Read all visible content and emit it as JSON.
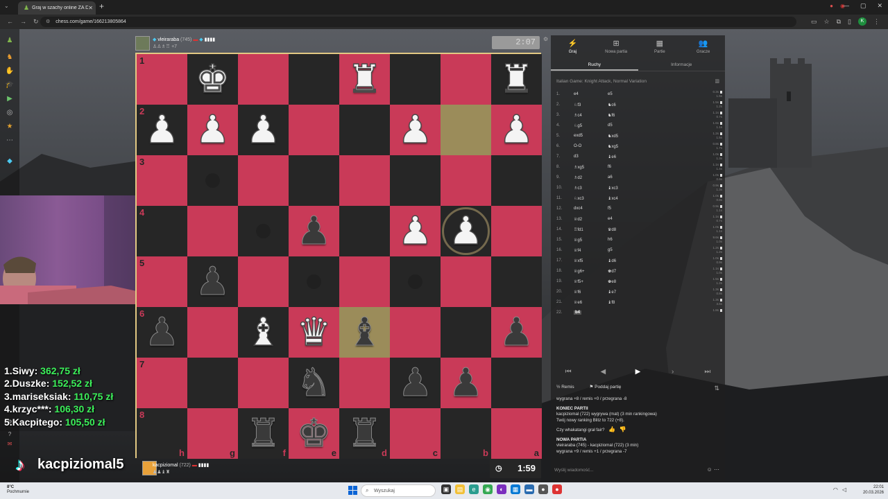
{
  "browser": {
    "tab_title": "Graj w szachy online ZA DARM...",
    "url": "chess.com/game/166213805864"
  },
  "top_player": {
    "name": "vleiraraba",
    "rating": "(745)",
    "captured_extra": "+7",
    "clock": "2:07"
  },
  "bottom_player": {
    "name": "kacpiziomal",
    "rating": "(722)",
    "clock": "1:59"
  },
  "board": {
    "ranks": [
      "1",
      "2",
      "3",
      "4",
      "5",
      "6",
      "7",
      "8"
    ],
    "files": [
      "h",
      "g",
      "f",
      "e",
      "d",
      "c",
      "b",
      "a"
    ]
  },
  "panel": {
    "tabs": [
      "Graj",
      "Nowa partia",
      "Partie",
      "Gracze"
    ],
    "subtabs": [
      "Ruchy",
      "Informacje"
    ],
    "opening": "Italian Game: Knight Attack, Normal Variation",
    "moves": [
      {
        "no": "1.",
        "w": "e4",
        "b": "e5",
        "tw": "0.3s",
        "tb": "1.5s"
      },
      {
        "no": "2.",
        "w": "♘f3",
        "b": "♞c6",
        "tw": "1.5s",
        "tb": "1.2s"
      },
      {
        "no": "3.",
        "w": "♗c4",
        "b": "♞f6",
        "tw": "1.1s",
        "tb": "0.7s"
      },
      {
        "no": "4.",
        "w": "♘g5",
        "b": "d5",
        "tw": "1.6s",
        "tb": "1.1s"
      },
      {
        "no": "5.",
        "w": "exd5",
        "b": "♞xd5",
        "tw": "1.2s",
        "tb": "1.5s"
      },
      {
        "no": "6.",
        "w": "O-O",
        "b": "♞xg5",
        "tw": "0.8s",
        "tb": "1.7s"
      },
      {
        "no": "7.",
        "w": "d3",
        "b": "♝e6",
        "tw": "1.0s",
        "tb": "1.3s"
      },
      {
        "no": "8.",
        "w": "♗xg5",
        "b": "f6",
        "tw": "1.1s",
        "tb": "1.4s"
      },
      {
        "no": "9.",
        "w": "♗d2",
        "b": "a6",
        "tw": "1.0s",
        "tb": "0.9s"
      },
      {
        "no": "10.",
        "w": "♗c3",
        "b": "♝xc3",
        "tw": "0.9s",
        "tb": "1.3s"
      },
      {
        "no": "11.",
        "w": "♘xc3",
        "b": "♝xc4",
        "tw": "1.0s",
        "tb": "0.8s"
      },
      {
        "no": "12.",
        "w": "dxc4",
        "b": "f5",
        "tw": "0.9s",
        "tb": "1.1s"
      },
      {
        "no": "13.",
        "w": "♕d2",
        "b": "e4",
        "tw": "1.1s",
        "tb": "0.7s"
      },
      {
        "no": "14.",
        "w": "♖fd1",
        "b": "♛d8",
        "tw": "1.0s",
        "tb": "1.1s"
      },
      {
        "no": "15.",
        "w": "♕g5",
        "b": "h6",
        "tw": "9.6s",
        "tb": "1.0s"
      },
      {
        "no": "16.",
        "w": "♕f4",
        "b": "g5",
        "tw": "1.2s",
        "tb": "1.2s"
      },
      {
        "no": "17.",
        "w": "♕xf5",
        "b": "♝d6",
        "tw": "1.0s",
        "tb": "0.9s"
      },
      {
        "no": "18.",
        "w": "♕g6+",
        "b": "♚d7",
        "tw": "1.1s",
        "tb": "1.0s"
      },
      {
        "no": "19.",
        "w": "♕f5+",
        "b": "♚e8",
        "tw": "1.5s",
        "tb": "1.2s"
      },
      {
        "no": "20.",
        "w": "♕f6",
        "b": "♝e7",
        "tw": "1.3s",
        "tb": "0.8s"
      },
      {
        "no": "21.",
        "w": "♕e6",
        "b": "♝f8",
        "tw": "1.3s",
        "tb": "3.6s"
      },
      {
        "no": "22.",
        "w": "b4",
        "b": "",
        "tw": "1.8s",
        "tb": ""
      }
    ],
    "draw_label": "Remis",
    "resign_label": "Poddaj partię",
    "record_line": "wygrana +8 / remis +0 / przegrana -8",
    "game_over_title": "KONIEC PARTII",
    "game_over_text": "kacpiziomal (722) wygrywa (mat) (3 min rankingowa)",
    "rating_text": "Twój nowy ranking Blitz to 722 (+8).",
    "fair_question": "Czy whakatangi grał fair?",
    "new_game_title": "NOWA PARTIA",
    "new_game_text": "vleiraraba (745) - kacpiziomal (722) (3 min)",
    "new_record_line": "wygrana +9 / remis +1 / przegrana -7",
    "chat_placeholder": "Wyślij wiadomość..."
  },
  "leaderboard": [
    {
      "rank": "1.",
      "name": "Siwy:",
      "amount": "362,75 zł"
    },
    {
      "rank": "2.",
      "name": "Duszke:",
      "amount": "152,52 zł"
    },
    {
      "rank": "3.",
      "name": "mariseksiak:",
      "amount": "110,75 zł"
    },
    {
      "rank": "4.",
      "name": "krzyc***:",
      "amount": "106,30 zł"
    },
    {
      "rank": "5.",
      "name": "Kacpitego:",
      "amount": "105,50 zł"
    }
  ],
  "tiktok_handle": "kacpiziomal5",
  "taskbar": {
    "weather_temp": "8°C",
    "weather_desc": "Pochmurnie",
    "search_placeholder": "Wyszukaj",
    "time": "22:01",
    "date": "20.03.2026"
  },
  "colors": {
    "light_square": "#c93a58",
    "dark_square": "#262626",
    "highlight": "#9b8c5a",
    "board_border": "#e3c983",
    "leaderboard_amount": "#3cf05a"
  }
}
